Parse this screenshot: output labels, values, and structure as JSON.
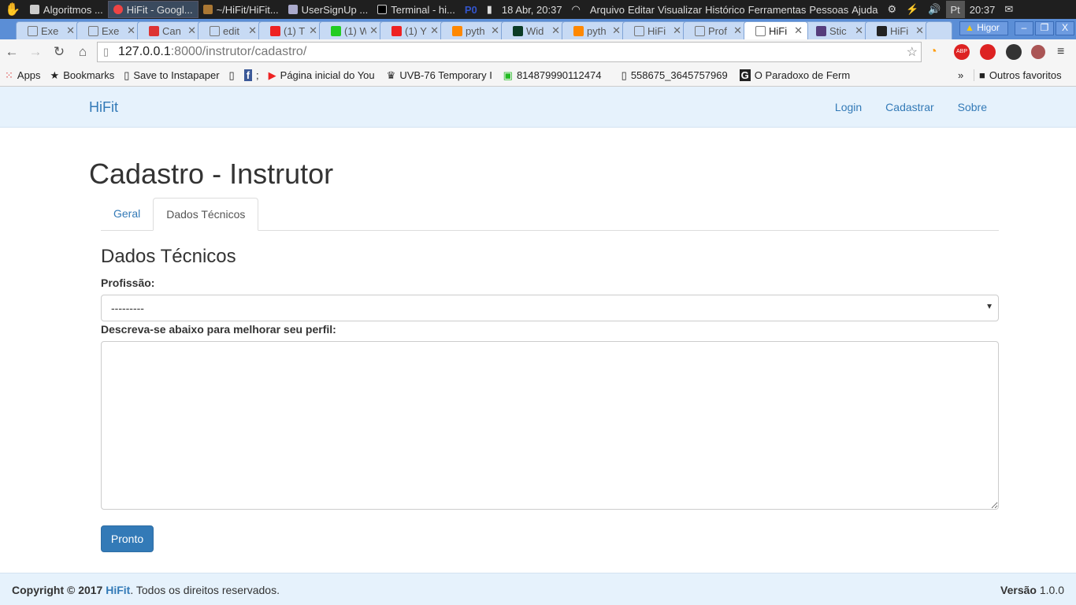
{
  "taskbar": {
    "windows": [
      "Algoritmos ...",
      "HiFit - Googl...",
      "~/HiFit/HiFit...",
      "UserSignUp ...",
      "Terminal - hi..."
    ],
    "workspace": "P0",
    "datetime": "18 Abr, 20:37",
    "menus": [
      "Arquivo",
      "Editar",
      "Visualizar",
      "Histórico",
      "Ferramentas",
      "Pessoas",
      "Ajuda"
    ],
    "lang": "Pt",
    "clock": "20:37"
  },
  "tabs": [
    {
      "title": "Exe"
    },
    {
      "title": "Exe"
    },
    {
      "title": "Can",
      "icon": "gmail"
    },
    {
      "title": "edit"
    },
    {
      "title": "(1) T",
      "icon": "youtube"
    },
    {
      "title": "(1) W",
      "icon": "whatsapp"
    },
    {
      "title": "(1) Y",
      "icon": "youtube"
    },
    {
      "title": "pyth",
      "icon": "stackoverflow"
    },
    {
      "title": "Wid",
      "icon": "django"
    },
    {
      "title": "pyth",
      "icon": "stackoverflow"
    },
    {
      "title": "HiFi"
    },
    {
      "title": "Prof"
    },
    {
      "title": "HiFi",
      "active": true
    },
    {
      "title": "Stic",
      "icon": "bootstrap"
    },
    {
      "title": "HiFi",
      "icon": "github"
    }
  ],
  "profile": "Higor",
  "url": {
    "host": "127.0.0.1",
    "path": ":8000/instrutor/cadastro/"
  },
  "bookmarks": [
    "Apps",
    "Bookmarks",
    "Save to Instapaper",
    "",
    ";",
    "Página inicial do You",
    "UVB-76 Temporary I",
    "814879990112474",
    "558675_3645757969",
    "O Paradoxo de Ferm"
  ],
  "other_bookmarks": "Outros favoritos",
  "nav": {
    "brand": "HiFit",
    "links": [
      "Login",
      "Cadastrar",
      "Sobre"
    ]
  },
  "page": {
    "title": "Cadastro - Instrutor",
    "tabs": [
      "Geral",
      "Dados Técnicos"
    ],
    "section": "Dados Técnicos",
    "profession_label": "Profissão:",
    "profession_value": "---------",
    "describe_label": "Descreva-se abaixo para melhorar seu perfil:",
    "submit": "Pronto"
  },
  "footer": {
    "copyright": "Copyright © 2017",
    "brand": "HiFit",
    "rights": ". Todos os direitos reservados.",
    "version_label": "Versão",
    "version": "1.0.0"
  }
}
